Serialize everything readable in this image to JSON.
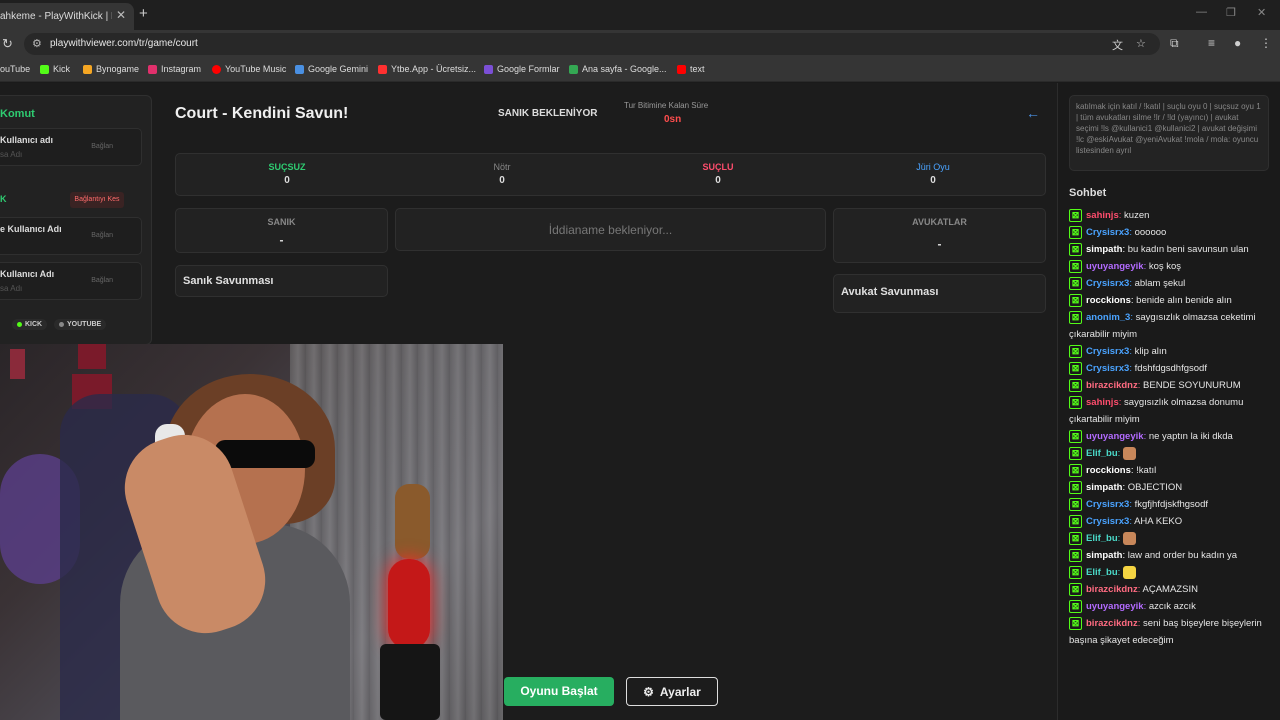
{
  "browser": {
    "tab_title": "ahkeme - PlayWithKick | Play",
    "url": "playwithviewer.com/tr/game/court",
    "bookmarks": [
      {
        "label": "ouTube",
        "color": "#ff0000"
      },
      {
        "label": "Kick",
        "color": "#53fc18"
      },
      {
        "label": "Bynogame",
        "color": "#f5a623"
      },
      {
        "label": "Instagram",
        "color": "#e1306c"
      },
      {
        "label": "YouTube Music",
        "color": "#ff0000"
      },
      {
        "label": "Google Gemini",
        "color": "#4a90e2"
      },
      {
        "label": "Ytbe.App - Ücretsiz...",
        "color": "#ff3030"
      },
      {
        "label": "Google Formlar",
        "color": "#7b4fd6"
      },
      {
        "label": "Ana sayfa - Google...",
        "color": "#34a853"
      },
      {
        "label": "text",
        "color": "#ff0000"
      }
    ]
  },
  "left_panel": {
    "title": "Komut",
    "card1": {
      "name": "Kullanıcı adı",
      "sub": "sa Adı",
      "button": "Bağlan"
    },
    "k_label": "K",
    "disconnect": "Bağlantıyı Kes",
    "card2": {
      "name": "e Kullanıcı Adı",
      "button": "Bağlan"
    },
    "card3": {
      "name": "Kullanıcı Adı",
      "sub": "sa Adı",
      "button": "Bağlan"
    },
    "platforms": [
      {
        "label": "KICK",
        "color": "#53fc18"
      },
      {
        "label": "YOUTUBE",
        "color": "#888888"
      }
    ]
  },
  "game": {
    "title": "Court - Kendini Savun!",
    "state": "SANIK BEKLENİYOR",
    "timer_label": "Tur Bitimine Kalan Süre",
    "timer_value": "0sn",
    "scores": [
      {
        "label": "SUÇSUZ",
        "value": "0",
        "color": "#2ecc71"
      },
      {
        "label": "Nötr",
        "value": "0",
        "color": "#888888"
      },
      {
        "label": "SUÇLU",
        "value": "0",
        "color": "#ff4d6d"
      },
      {
        "label": "Jüri Oyu",
        "value": "0",
        "color": "#4aa3ff"
      }
    ],
    "defendant_label": "SANIK",
    "defendant_value": "-",
    "indictment": "İddianame bekleniyor...",
    "lawyers_label": "AVUKATLAR",
    "lawyers_value": "-",
    "defendant_defense": "Sanık Savunması",
    "lawyer_defense": "Avukat Savunması",
    "start_button": "Oyunu Başlat",
    "settings_button": "Ayarlar"
  },
  "help_text": "katılmak için katıl / !katıl | suçlu oyu 0 | suçsuz oyu 1 | tüm avukatları silme !lr / !ld (yayıncı) | avukat seçimi !ls @kullanici1 @kullanici2 | avukat değişimi !lc @eskiAvukat @yeniAvukat !mola / mola: oyuncu listesinden ayrıl",
  "chat": {
    "title": "Sohbet",
    "messages": [
      {
        "user": "sahinjs",
        "color": "#ff4d6d",
        "text": "kuzen"
      },
      {
        "user": "Crysisrx3",
        "color": "#4aa3ff",
        "text": "oooooo"
      },
      {
        "user": "simpath",
        "color": "#ffffff",
        "text": "bu kadın beni savunsun ulan"
      },
      {
        "user": "uyuyangeyik",
        "color": "#b36bff",
        "text": "koş koş"
      },
      {
        "user": "Crysisrx3",
        "color": "#4aa3ff",
        "text": "ablam şekul"
      },
      {
        "user": "rocckions",
        "color": "#ffffff",
        "text": "benide alın benide alın"
      },
      {
        "user": "anonim_3",
        "color": "#4aa3ff",
        "text": "saygısızlık olmazsa ceketimi çıkarabilir miyim"
      },
      {
        "user": "Crysisrx3",
        "color": "#4aa3ff",
        "text": "klip alın"
      },
      {
        "user": "Crysisrx3",
        "color": "#4aa3ff",
        "text": "fdshfdgsdhfgsodf"
      },
      {
        "user": "birazcikdnz",
        "color": "#ff6b81",
        "text": "BENDE SOYUNURUM"
      },
      {
        "user": "sahinjs",
        "color": "#ff4d6d",
        "text": "saygısızlık olmazsa donumu çıkartabilir miyim"
      },
      {
        "user": "uyuyangeyik",
        "color": "#b36bff",
        "text": "ne yaptın la iki dkda"
      },
      {
        "user": "Elif_bu",
        "color": "#4ad9c8",
        "text": "",
        "emote": "#c8875a"
      },
      {
        "user": "rocckions",
        "color": "#ffffff",
        "text": "!katıl"
      },
      {
        "user": "simpath",
        "color": "#ffffff",
        "text": "OBJECTION"
      },
      {
        "user": "Crysisrx3",
        "color": "#4aa3ff",
        "text": "fkgfjhfdjskfhgsodf"
      },
      {
        "user": "Crysisrx3",
        "color": "#4aa3ff",
        "text": "AHA KEKO"
      },
      {
        "user": "Elif_bu",
        "color": "#4ad9c8",
        "text": "",
        "emote": "#c8875a"
      },
      {
        "user": "simpath",
        "color": "#ffffff",
        "text": "law and order bu kadın ya"
      },
      {
        "user": "Elif_bu",
        "color": "#4ad9c8",
        "text": "",
        "emote": "#f5d442"
      },
      {
        "user": "birazcikdnz",
        "color": "#ff6b81",
        "text": "AÇAMAZSIN"
      },
      {
        "user": "uyuyangeyik",
        "color": "#b36bff",
        "text": "azcık azcık"
      },
      {
        "user": "birazcikdnz",
        "color": "#ff6b81",
        "text": "seni baş bişeylere bişeylerin başına şikayet edeceğim"
      }
    ]
  }
}
